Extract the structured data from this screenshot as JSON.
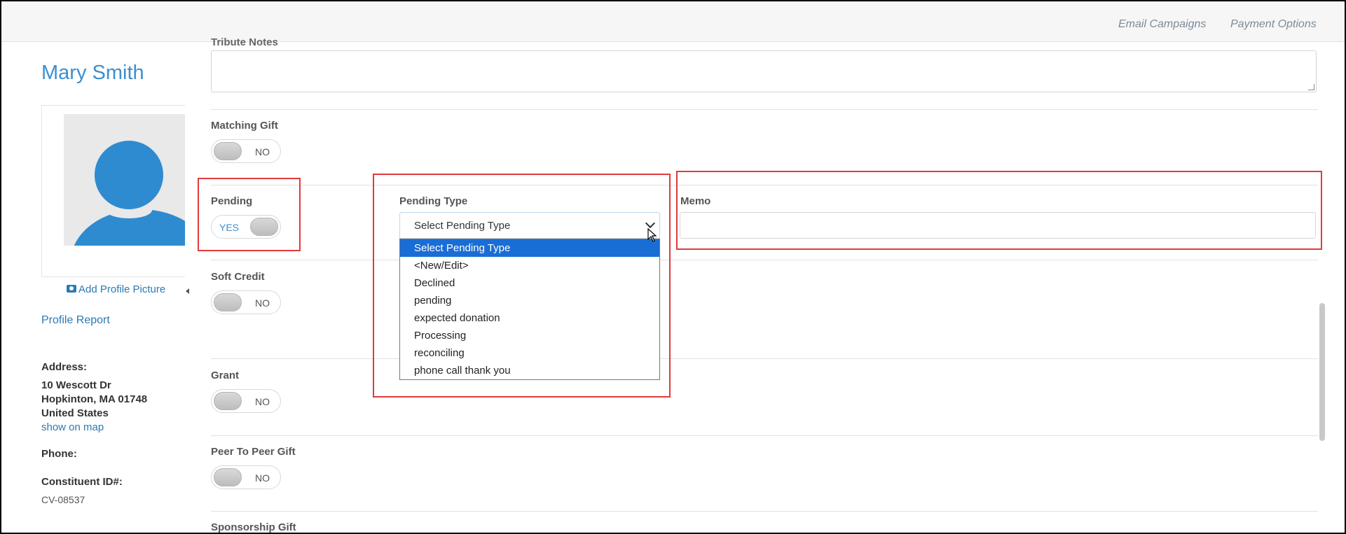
{
  "topbar": {
    "links": [
      "Email Campaigns",
      "Payment Options"
    ]
  },
  "profile": {
    "name": "Mary Smith",
    "add_picture": "Add Profile Picture",
    "profile_report": "Profile Report",
    "address_label": "Address:",
    "address_line1": "10 Wescott Dr",
    "address_line2": "Hopkinton, MA 01748",
    "address_line3": "United States",
    "show_on_map": "show on map",
    "phone_label": "Phone:",
    "constituent_label": "Constituent ID#:",
    "constituent_id": "CV-08537"
  },
  "form": {
    "tribute_notes_label": "Tribute Notes",
    "matching_gift": {
      "label": "Matching Gift",
      "state": "NO"
    },
    "pending": {
      "label": "Pending",
      "state": "YES"
    },
    "pending_type": {
      "label": "Pending Type",
      "selected": "Select Pending Type",
      "options": [
        "Select Pending Type",
        "<New/Edit>",
        "Declined",
        "pending",
        "expected donation",
        "Processing",
        "reconciling",
        "phone call thank you"
      ]
    },
    "memo": {
      "label": "Memo",
      "value": ""
    },
    "soft_credit": {
      "label": "Soft Credit",
      "state": "NO"
    },
    "grant": {
      "label": "Grant",
      "state": "NO"
    },
    "peer_to_peer": {
      "label": "Peer To Peer Gift",
      "state": "NO"
    },
    "sponsorship_label": "Sponsorship Gift"
  },
  "colors": {
    "accent": "#3d8fd0",
    "link": "#2a7ab5",
    "highlight_border": "#e03b3b",
    "dropdown_selected": "#1a6dd4"
  }
}
